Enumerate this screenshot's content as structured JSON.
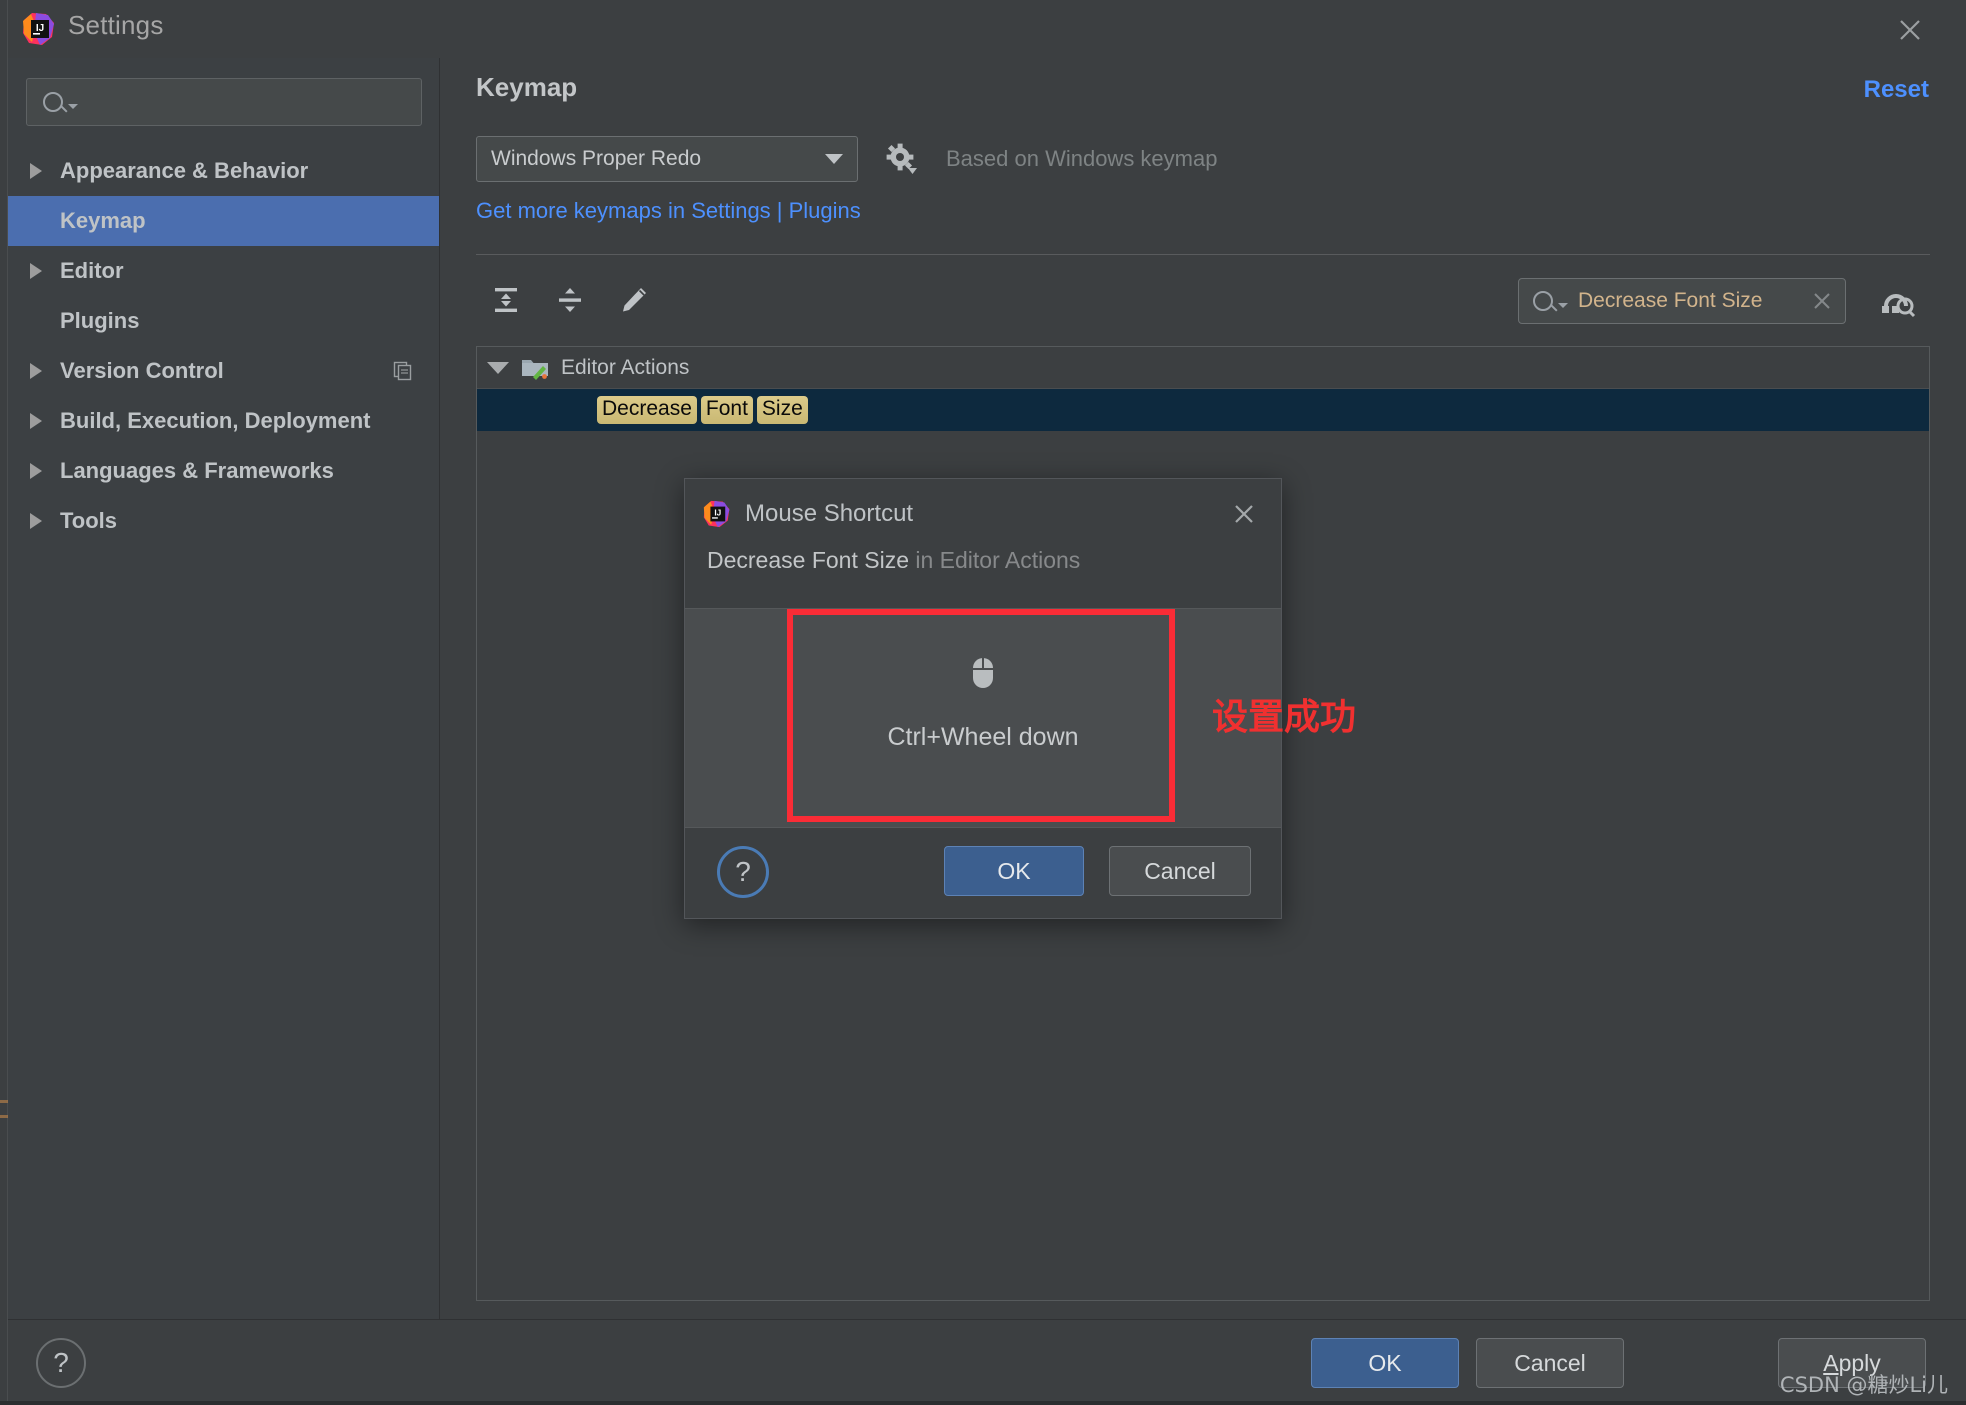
{
  "window": {
    "title": "Settings",
    "logo_icon": "intellij-idea-logo",
    "close_icon": "close-icon"
  },
  "sidebar": {
    "search": {
      "value": "",
      "placeholder": "",
      "icon": "search-icon"
    },
    "items": [
      {
        "label": "Appearance & Behavior",
        "expandable": true,
        "selected": false,
        "trailing_icon": ""
      },
      {
        "label": "Keymap",
        "expandable": false,
        "selected": true,
        "trailing_icon": ""
      },
      {
        "label": "Editor",
        "expandable": true,
        "selected": false,
        "trailing_icon": ""
      },
      {
        "label": "Plugins",
        "expandable": false,
        "selected": false,
        "trailing_icon": ""
      },
      {
        "label": "Version Control",
        "expandable": true,
        "selected": false,
        "trailing_icon": "copy-icon"
      },
      {
        "label": "Build, Execution, Deployment",
        "expandable": true,
        "selected": false,
        "trailing_icon": ""
      },
      {
        "label": "Languages & Frameworks",
        "expandable": true,
        "selected": false,
        "trailing_icon": ""
      },
      {
        "label": "Tools",
        "expandable": true,
        "selected": false,
        "trailing_icon": ""
      }
    ]
  },
  "main": {
    "page_title": "Keymap",
    "reset_label": "Reset",
    "keymap_combo_value": "Windows Proper Redo",
    "gear_icon": "gear-icon",
    "based_on_text": "Based on Windows keymap",
    "get_more_link": "Get more keymaps in Settings | Plugins",
    "toolbar": [
      {
        "name": "expand-all-icon",
        "tooltip": "Expand All"
      },
      {
        "name": "collapse-all-icon",
        "tooltip": "Collapse All"
      },
      {
        "name": "edit-shortcut-icon",
        "tooltip": "Edit Shortcut"
      }
    ],
    "find": {
      "value": "Decrease Font Size",
      "search_icon": "search-icon",
      "clear_icon": "clear-icon"
    },
    "filter_icon": "filter-by-shortcut-icon"
  },
  "tree": {
    "group": {
      "label": "Editor Actions",
      "icon": "editor-actions-folder-icon",
      "expanded": true
    },
    "selected_row_tokens": [
      "Decrease",
      "Font",
      "Size"
    ]
  },
  "dialog": {
    "logo_icon": "intellij-idea-logo",
    "title": "Mouse Shortcut",
    "close_icon": "close-icon",
    "subject": "Decrease Font Size",
    "context": "in Editor Actions",
    "mouse_icon": "mouse-wheel-icon",
    "shortcut_text": "Ctrl+Wheel down",
    "help_label": "?",
    "ok_label": "OK",
    "cancel_label": "Cancel"
  },
  "annotation": {
    "text": "设置成功",
    "color": "#f03030"
  },
  "bottom_bar": {
    "help_label": "?",
    "ok_label": "OK",
    "cancel_label": "Cancel",
    "apply_label_first": "A",
    "apply_label_rest": "pply"
  },
  "watermark": {
    "text": "CSDN @糖炒Li儿"
  },
  "colors": {
    "accent_blue": "#4b6eaf",
    "link_blue": "#4d90fe",
    "selection_row": "#0d293e",
    "highlight_token": "#c9b873",
    "annotation_red": "#f03030",
    "window_bg": "#3c3f41",
    "sidebar_bg": "#3c4043"
  }
}
